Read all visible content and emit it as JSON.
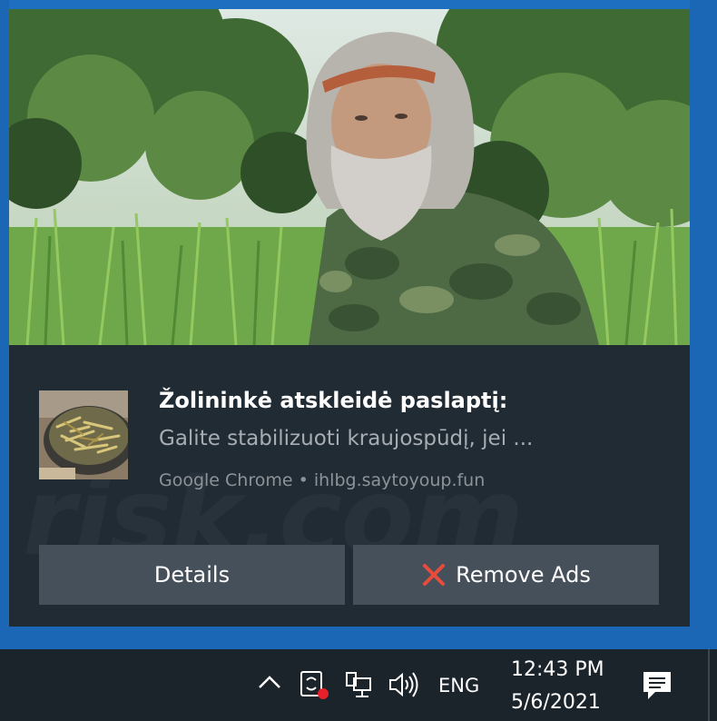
{
  "notification": {
    "title": "Žolininkė atskleidė paslaptį:",
    "body": "Galite stabilizuoti kraujospūdį, jei ...",
    "attribution": "Google Chrome • ihlbg.saytoyoup.fun",
    "buttons": {
      "details_label": "Details",
      "remove_ads_label": "Remove Ads"
    },
    "watermark": "risk.com"
  },
  "taskbar": {
    "language": "ENG",
    "time": "12:43 PM",
    "date": "5/6/2021",
    "icons": [
      "chevron-up-icon",
      "sync-alert-icon",
      "network-icon",
      "volume-icon",
      "action-center-icon"
    ]
  },
  "colors": {
    "toast_bg": "#212b34",
    "button_bg": "#46505a",
    "taskbar_bg": "#1b232b",
    "desktop_blue": "#1b67b6",
    "remove_icon": "#e74c3c"
  }
}
